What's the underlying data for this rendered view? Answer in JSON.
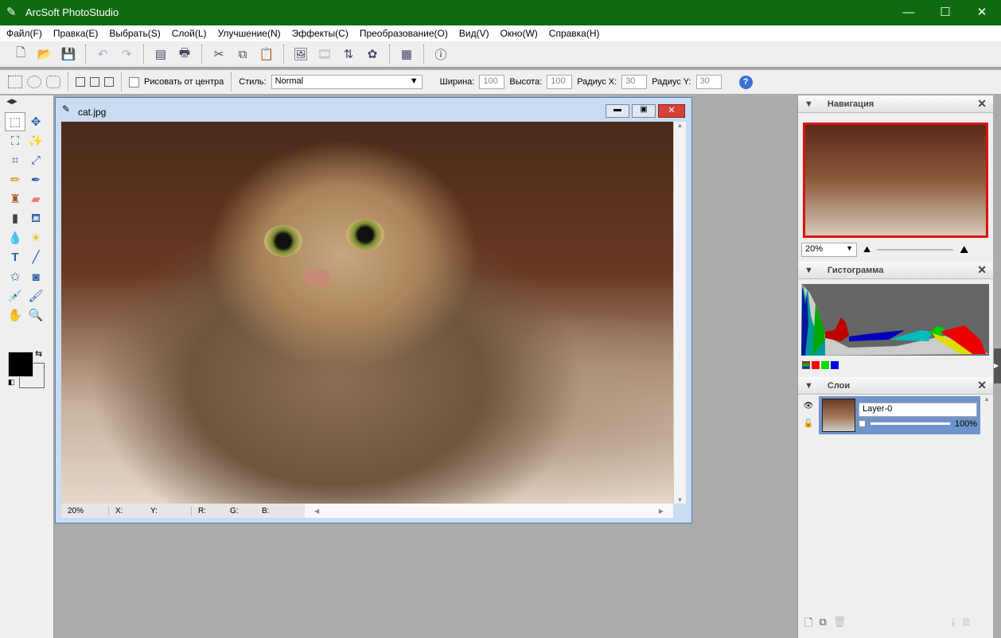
{
  "app": {
    "title": "ArcSoft PhotoStudio"
  },
  "menu": [
    "Файл(F)",
    "Правка(E)",
    "Выбрать(S)",
    "Слой(L)",
    "Улучшение(N)",
    "Эффекты(C)",
    "Преобразование(O)",
    "Вид(V)",
    "Окно(W)",
    "Справка(H)"
  ],
  "toolbar": [
    "new-icon",
    "open-icon",
    "save-icon",
    "undo-icon",
    "redo-icon",
    "scan-icon",
    "print-icon",
    "cut-icon",
    "copy-icon",
    "paste-icon",
    "photo-icon",
    "film-icon",
    "batch-icon",
    "enhance-icon",
    "view-icon",
    "info-icon"
  ],
  "options": {
    "draw_from_center": "Рисовать от центра",
    "style_label": "Стиль:",
    "style_value": "Normal",
    "width_label": "Ширина:",
    "width_value": "100",
    "height_label": "Высота:",
    "height_value": "100",
    "rx_label": "Радиус X:",
    "rx_value": "30",
    "ry_label": "Радиус Y:",
    "ry_value": "30"
  },
  "document": {
    "title": "cat.jpg",
    "zoom": "20%",
    "x_label": "X:",
    "y_label": "Y:",
    "r_label": "R:",
    "g_label": "G:",
    "b_label": "B:"
  },
  "navigation": {
    "title": "Навигация",
    "zoom": "20%"
  },
  "histogram": {
    "title": "Гистограмма",
    "channels": [
      "#ff0000",
      "#00cc00",
      "#0000ff"
    ]
  },
  "layers": {
    "title": "Слои",
    "layer_name": "Layer-0",
    "opacity": "100%"
  },
  "colors": {
    "foreground": "#000000",
    "background": "#ffffff",
    "titlebar": "#0f6b12"
  }
}
